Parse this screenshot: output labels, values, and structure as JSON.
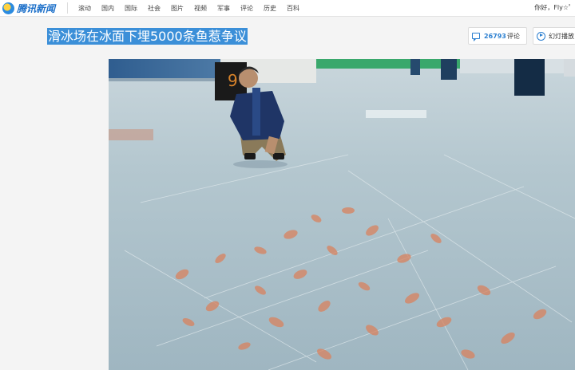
{
  "site": {
    "logo_text": "腾讯新闻"
  },
  "nav": {
    "items": [
      "滚动",
      "国内",
      "国际",
      "社会",
      "图片",
      "视频",
      "军事",
      "评论",
      "历史",
      "百科"
    ]
  },
  "user": {
    "greeting": "你好，Fly☆゜"
  },
  "article": {
    "title": "滑冰场在冰面下埋5000条鱼惹争议",
    "comment_count": "26793",
    "comment_label": "评论",
    "slideshow_label": "幻灯播放"
  },
  "photo": {
    "watermark": "",
    "description_icon": "photo"
  },
  "colors": {
    "title_highlight": "#3b8fd8",
    "accent": "#2b7fd0"
  }
}
